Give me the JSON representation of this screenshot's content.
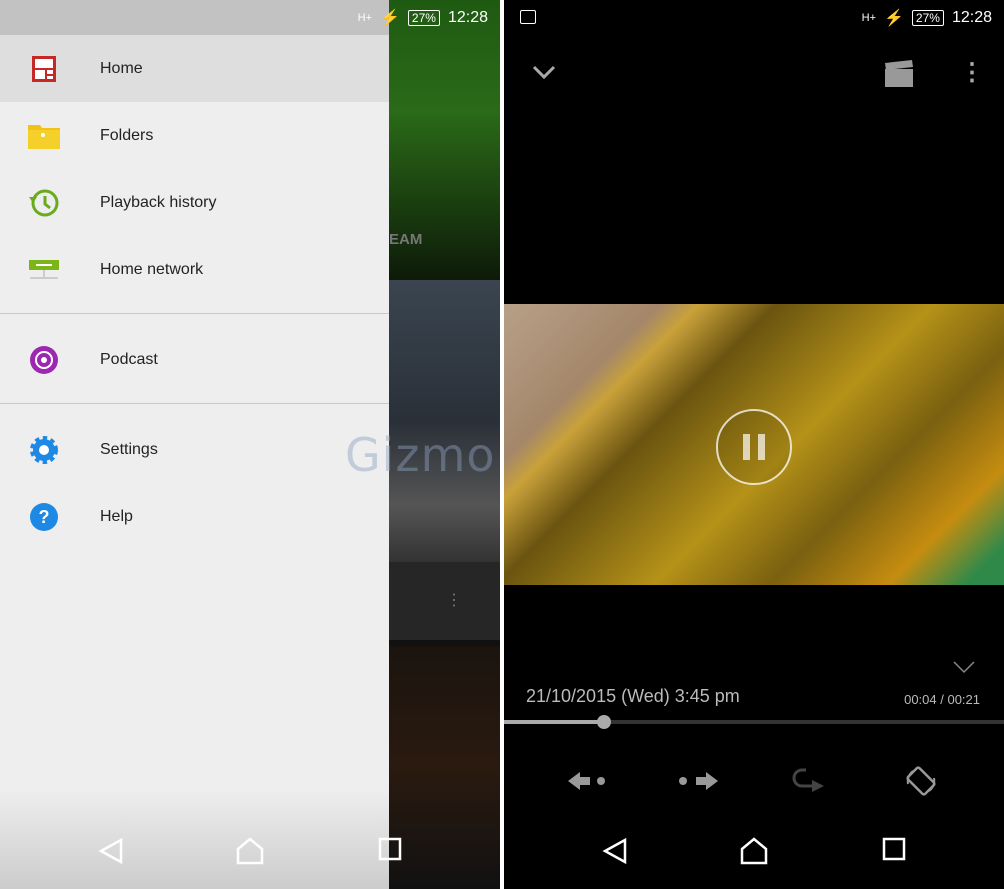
{
  "status_bar": {
    "network": "H+",
    "battery": "27%",
    "time": "12:28"
  },
  "drawer": {
    "items": [
      {
        "label": "Home",
        "icon": "home-grid-icon",
        "selected": true
      },
      {
        "label": "Folders",
        "icon": "folder-icon"
      },
      {
        "label": "Playback history",
        "icon": "history-icon"
      },
      {
        "label": "Home network",
        "icon": "home-network-icon"
      },
      {
        "label": "Podcast",
        "icon": "podcast-icon"
      },
      {
        "label": "Settings",
        "icon": "gear-icon"
      },
      {
        "label": "Help",
        "icon": "help-icon"
      }
    ]
  },
  "background_partial_text": "EAM",
  "watermark": "GizmoBolt",
  "player": {
    "date": "21/10/2015 (Wed) 3:45 pm",
    "time": "00:04 / 00:21",
    "progress": 0.2
  },
  "colors": {
    "accent_home": "#c62828",
    "folder": "#f2c316",
    "history": "#6aab1e",
    "network": "#7cb518",
    "podcast": "#9c27b0",
    "settings": "#1e88e5"
  }
}
